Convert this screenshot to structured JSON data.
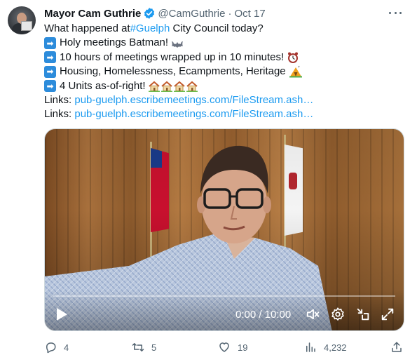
{
  "author": {
    "name": "Mayor Cam Guthrie",
    "handle": "@CamGuthrie",
    "separator": "·",
    "date": "Oct 17"
  },
  "tweet": {
    "line1_prefix": "What happened at ",
    "line1_hashtag": "#Guelph",
    "line1_suffix": " City Council today?",
    "bullet1": "Holy meetings Batman!",
    "bullet2": "10 hours of meetings wrapped up in 10 minutes!",
    "bullet3": "Housing, Homelessness, Ecampments, Heritage",
    "bullet4": "4 Units as-of-right!",
    "links1_label": "Links: ",
    "links1_url": "pub-guelph.escribemeetings.com/FileStream.ash…",
    "links2_label": "Links: ",
    "links2_url": "pub-guelph.escribemeetings.com/FileStream.ash…"
  },
  "video": {
    "time": "0:00 / 10:00",
    "progress_fraction": 0
  },
  "actions": {
    "replies": "4",
    "retweets": "5",
    "likes": "19",
    "views": "4,232"
  },
  "colors": {
    "link": "#1d9bf0",
    "muted": "#536471",
    "text": "#0f1419"
  },
  "icons": [
    "verified-badge-icon",
    "more-icon",
    "arrow-right-icon",
    "bat-icon",
    "alarm-clock-icon",
    "tent-icon",
    "house-icon",
    "play-icon",
    "volume-icon",
    "settings-icon",
    "minimize-icon",
    "fullscreen-icon",
    "reply-icon",
    "retweet-icon",
    "like-icon",
    "views-icon",
    "share-icon"
  ]
}
